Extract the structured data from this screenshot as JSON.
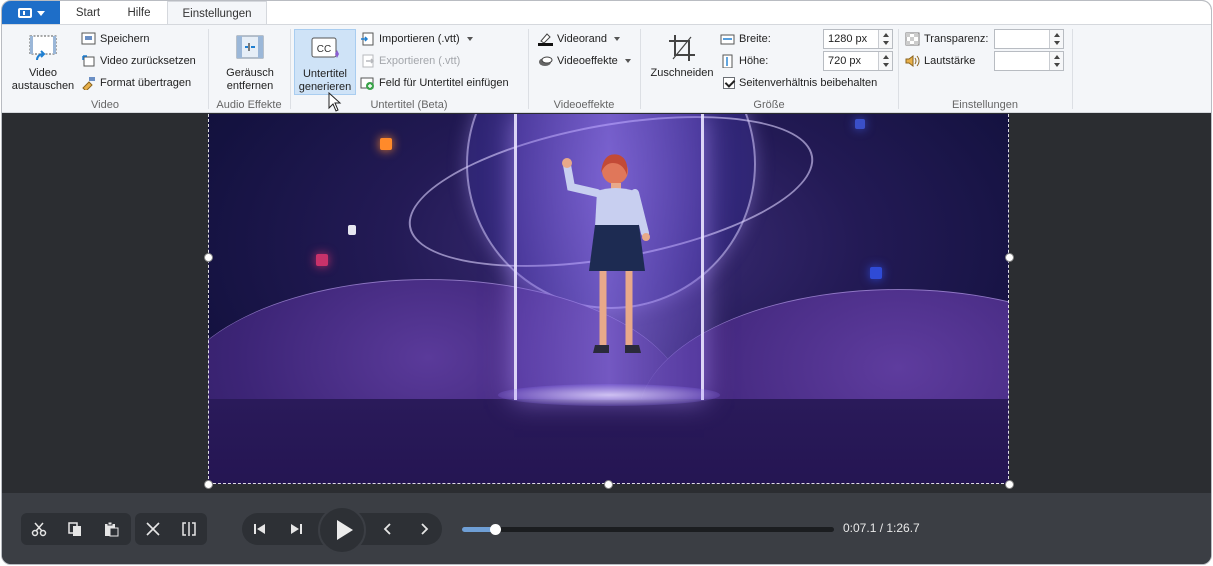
{
  "tabs": {
    "app_menu_icon": "app-menu-icon",
    "items": [
      "Start",
      "Hilfe",
      "Einstellungen"
    ],
    "active": "Einstellungen"
  },
  "ribbon": {
    "video": {
      "group_label": "Video",
      "replace_label_1": "Video",
      "replace_label_2": "austauschen",
      "save": "Speichern",
      "reset": "Video zurücksetzen",
      "format": "Format übertragen"
    },
    "audio": {
      "group_label": "Audio Effekte",
      "noise_label_1": "Geräusch",
      "noise_label_2": "entfernen"
    },
    "subtitles": {
      "group_label": "Untertitel (Beta)",
      "generate_label_1": "Untertitel",
      "generate_label_2": "generieren",
      "import": "Importieren (.vtt)",
      "export": "Exportieren (.vtt)",
      "insert_field": "Feld für Untertitel einfügen"
    },
    "effects": {
      "group_label": "Videoeffekte",
      "border": "Videorand",
      "effects": "Videoeffekte"
    },
    "size": {
      "group_label": "Größe",
      "crop": "Zuschneiden",
      "width_label": "Breite:",
      "width_value": "1280 px",
      "height_label": "Höhe:",
      "height_value": "720 px",
      "keep_ratio": "Seitenverhältnis beibehalten",
      "keep_ratio_checked": true
    },
    "settings": {
      "group_label": "Einstellungen",
      "transparency_label": "Transparenz:",
      "transparency_value": "",
      "volume_label": "Lautstärke",
      "volume_value": ""
    }
  },
  "player": {
    "time_display": "0:07.1 / 1:26.7",
    "progress": 0.088
  }
}
